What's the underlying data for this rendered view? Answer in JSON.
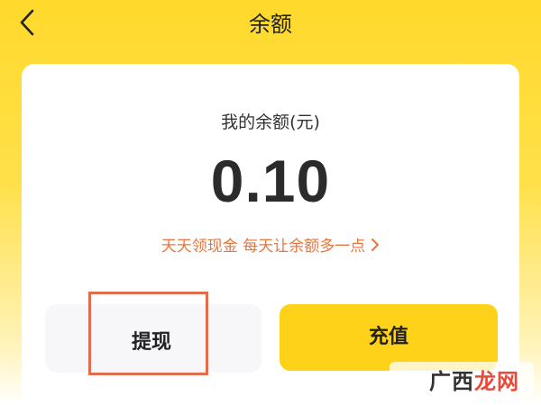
{
  "header": {
    "title": "余额",
    "back_icon": "chevron-left-icon"
  },
  "balance": {
    "label": "我的余额(元)",
    "amount": "0.10"
  },
  "promo": {
    "text": "天天领现金 每天让余额多一点",
    "icon": "chevron-right-icon"
  },
  "actions": {
    "withdraw_label": "提现",
    "recharge_label": "充值"
  },
  "watermark": {
    "part1": "广西",
    "part2": "龙网"
  },
  "colors": {
    "background_yellow": "#ffd92b",
    "accent_orange": "#e8743b",
    "recharge_yellow": "#ffd21a",
    "highlight_red": "#e26d4e",
    "text_dark": "#222222"
  }
}
